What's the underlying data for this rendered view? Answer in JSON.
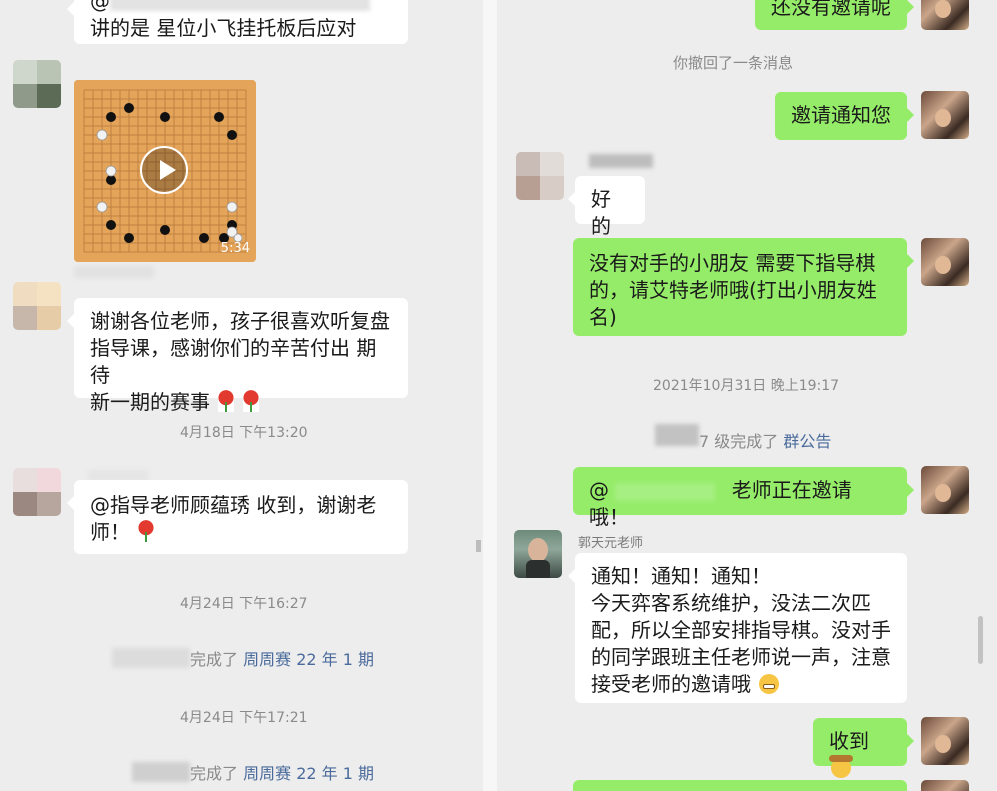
{
  "left": {
    "msg_top": {
      "lines": [
        "@",
        "讲的是 星位小飞挂托板后应对"
      ]
    },
    "video": {
      "duration": "5:34"
    },
    "msg_thanks": {
      "lines": [
        "谢谢各位老师，孩子很喜欢听复盘",
        "指导课，感谢你们的辛苦付出 期待",
        "新一期的赛事"
      ]
    },
    "time_1": "4月18日 下午13:20",
    "msg_reply": {
      "lines": [
        "@指导老师顾蕴琇  收到，谢谢老",
        "师！"
      ]
    },
    "time_2": "4月24日 下午16:27",
    "sys_1": {
      "text": "完成了",
      "link": "周周赛 22 年 1 期"
    },
    "time_3": "4月24日 下午17:21",
    "sys_2": {
      "text": "完成了",
      "link": "周周赛 22 年 1 期"
    }
  },
  "right": {
    "msg_top": "还没有邀请呢",
    "recalled": "你撤回了一条消息",
    "msg_invite": "邀请通知您",
    "msg_ok": "好的",
    "msg_need": {
      "lines": [
        "没有对手的小朋友  需要下指导棋",
        "的，请艾特老师哦(打出小朋友姓",
        "名)"
      ]
    },
    "time_1": "2021年10月31日 晚上19:17",
    "sys_1": {
      "text": "7 级完成了",
      "link": "群公告"
    },
    "msg_at": {
      "prefix": "@",
      "text": "老师正在邀请哦！"
    },
    "sender_name": "郭天元老师",
    "msg_notice": {
      "lines": [
        "通知！通知！通知！",
        "今天弈客系统维护，没法二次匹",
        "配，所以全部安排指导棋。没对手",
        "的同学跟班主任老师说一声，注意",
        "接受老师的邀请哦"
      ]
    },
    "msg_received": "收到"
  },
  "colors": {
    "background": "#ededed",
    "bubble_self": "#95ec69",
    "bubble_other": "#ffffff",
    "link": "#4b6b9c",
    "time_text": "#8a8a8a"
  },
  "icons": [
    "play-icon",
    "rose-emoji",
    "grin-emoji",
    "cowboy-emoji"
  ]
}
